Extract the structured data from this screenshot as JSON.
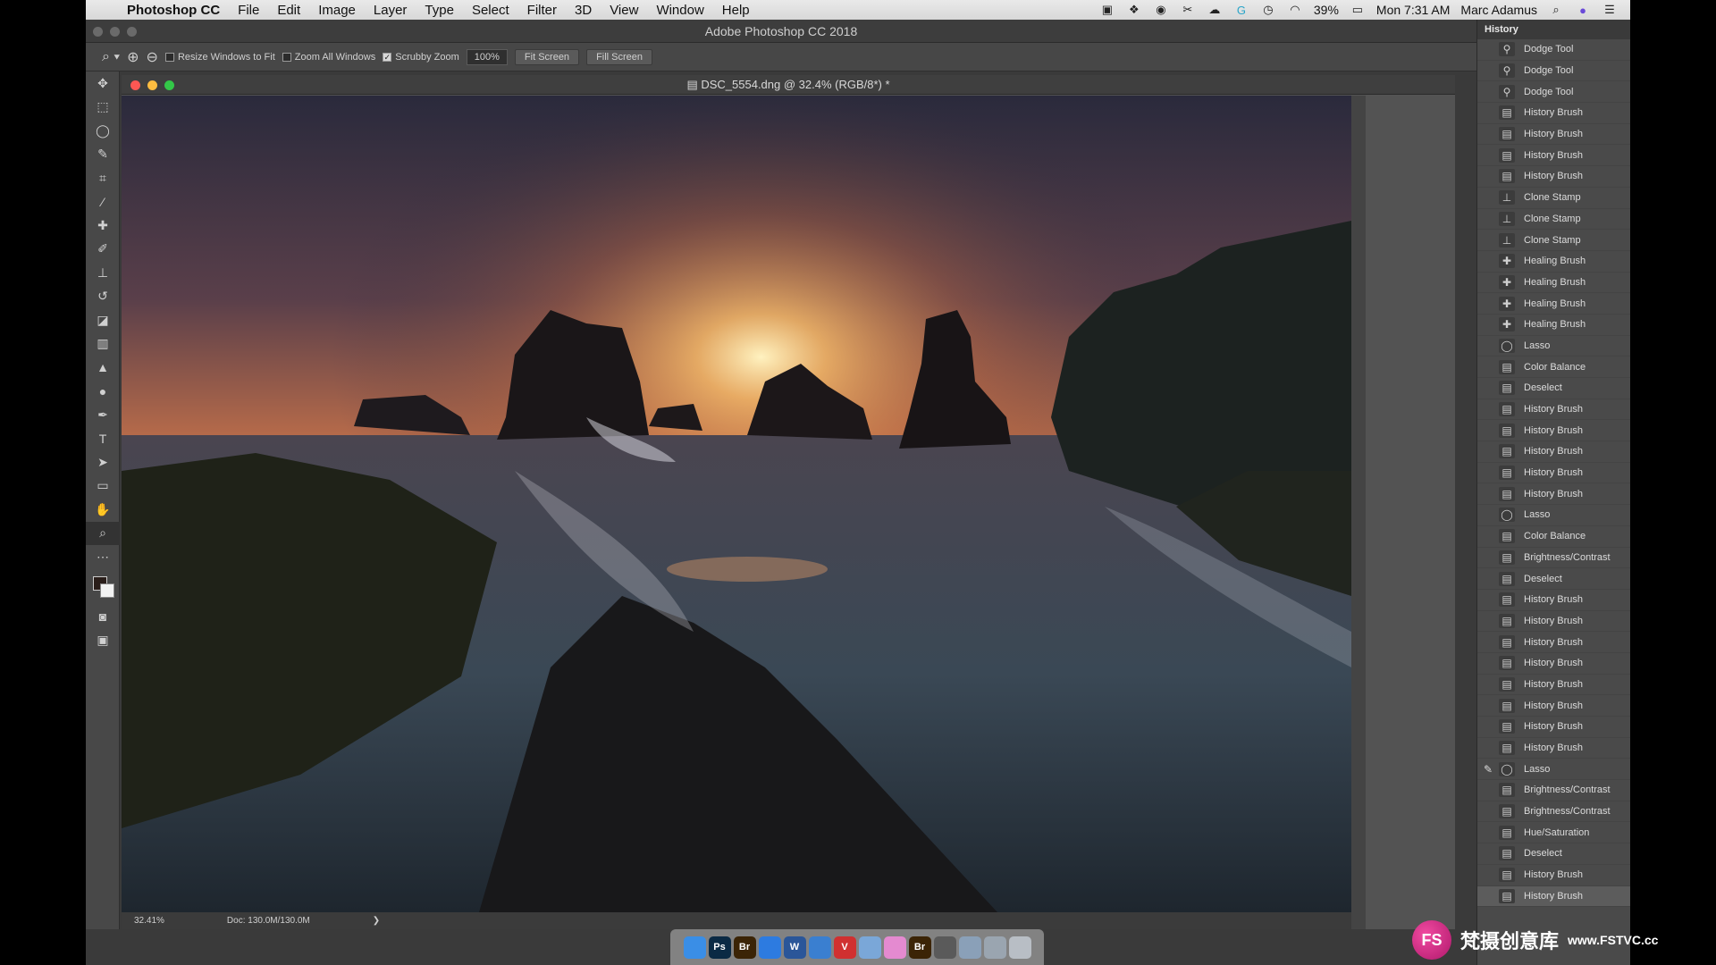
{
  "menubar": {
    "app_name": "Photoshop CC",
    "items": [
      "File",
      "Edit",
      "Image",
      "Layer",
      "Type",
      "Select",
      "Filter",
      "3D",
      "View",
      "Window",
      "Help"
    ],
    "battery": "39%",
    "clock": "Mon 7:31 AM",
    "user": "Marc Adamus",
    "status_icons": [
      "camera-icon",
      "dropbox-icon",
      "creative-cloud-icon",
      "tool-icon",
      "cloud-icon",
      "grammarly-icon",
      "time-machine-icon",
      "wifi-icon",
      "battery-icon"
    ]
  },
  "app_title": "Adobe Photoshop CC 2018",
  "options_bar": {
    "resize_windows": "Resize Windows to Fit",
    "zoom_all": "Zoom All Windows",
    "scrubby_zoom": "Scrubby Zoom",
    "zoom_value": "100%",
    "fit_screen": "Fit Screen",
    "fill_screen": "Fill Screen",
    "resize_checked": false,
    "zoom_all_checked": false,
    "scrubby_checked": true
  },
  "document": {
    "title": "DSC_5554.dng @ 32.4% (RGB/8*) *",
    "zoom": "32.41%",
    "doc_size": "Doc: 130.0M/130.0M",
    "arrow": "❯"
  },
  "history": {
    "tab_label": "History",
    "items": [
      {
        "label": "Dodge Tool",
        "icon": "dodge-icon"
      },
      {
        "label": "Dodge Tool",
        "icon": "dodge-icon"
      },
      {
        "label": "Dodge Tool",
        "icon": "dodge-icon"
      },
      {
        "label": "History Brush",
        "icon": "history-brush-icon"
      },
      {
        "label": "History Brush",
        "icon": "history-brush-icon"
      },
      {
        "label": "History Brush",
        "icon": "history-brush-icon"
      },
      {
        "label": "History Brush",
        "icon": "history-brush-icon"
      },
      {
        "label": "Clone Stamp",
        "icon": "clone-stamp-icon"
      },
      {
        "label": "Clone Stamp",
        "icon": "clone-stamp-icon"
      },
      {
        "label": "Clone Stamp",
        "icon": "clone-stamp-icon"
      },
      {
        "label": "Healing Brush",
        "icon": "healing-brush-icon"
      },
      {
        "label": "Healing Brush",
        "icon": "healing-brush-icon"
      },
      {
        "label": "Healing Brush",
        "icon": "healing-brush-icon"
      },
      {
        "label": "Healing Brush",
        "icon": "healing-brush-icon"
      },
      {
        "label": "Lasso",
        "icon": "lasso-icon"
      },
      {
        "label": "Color Balance",
        "icon": "adjustment-icon"
      },
      {
        "label": "Deselect",
        "icon": "adjustment-icon"
      },
      {
        "label": "History Brush",
        "icon": "history-brush-icon"
      },
      {
        "label": "History Brush",
        "icon": "history-brush-icon"
      },
      {
        "label": "History Brush",
        "icon": "history-brush-icon"
      },
      {
        "label": "History Brush",
        "icon": "history-brush-icon"
      },
      {
        "label": "History Brush",
        "icon": "history-brush-icon"
      },
      {
        "label": "Lasso",
        "icon": "lasso-icon"
      },
      {
        "label": "Color Balance",
        "icon": "adjustment-icon"
      },
      {
        "label": "Brightness/Contrast",
        "icon": "adjustment-icon"
      },
      {
        "label": "Deselect",
        "icon": "adjustment-icon"
      },
      {
        "label": "History Brush",
        "icon": "history-brush-icon"
      },
      {
        "label": "History Brush",
        "icon": "history-brush-icon"
      },
      {
        "label": "History Brush",
        "icon": "history-brush-icon"
      },
      {
        "label": "History Brush",
        "icon": "history-brush-icon"
      },
      {
        "label": "History Brush",
        "icon": "history-brush-icon"
      },
      {
        "label": "History Brush",
        "icon": "history-brush-icon"
      },
      {
        "label": "History Brush",
        "icon": "history-brush-icon"
      },
      {
        "label": "History Brush",
        "icon": "history-brush-icon"
      },
      {
        "label": "Lasso",
        "icon": "lasso-icon",
        "source_mark": true
      },
      {
        "label": "Brightness/Contrast",
        "icon": "adjustment-icon"
      },
      {
        "label": "Brightness/Contrast",
        "icon": "adjustment-icon"
      },
      {
        "label": "Hue/Saturation",
        "icon": "adjustment-icon"
      },
      {
        "label": "Deselect",
        "icon": "adjustment-icon"
      },
      {
        "label": "History Brush",
        "icon": "history-brush-icon"
      },
      {
        "label": "History Brush",
        "icon": "history-brush-icon",
        "selected": true
      }
    ]
  },
  "dock": {
    "apps": [
      {
        "label": "",
        "icon": "finder-icon",
        "color": "#3a8ee6"
      },
      {
        "label": "Ps",
        "icon": "photoshop-icon",
        "color": "#0b2a44"
      },
      {
        "label": "Br",
        "icon": "bridge-icon",
        "color": "#3b2406"
      },
      {
        "label": "",
        "icon": "safari-icon",
        "color": "#2d7be0"
      },
      {
        "label": "W",
        "icon": "word-icon",
        "color": "#2a5699"
      },
      {
        "label": "",
        "icon": "chrome-icon",
        "color": "#3a7fd0"
      },
      {
        "label": "V",
        "icon": "app-v-icon",
        "color": "#d03030"
      },
      {
        "label": "",
        "icon": "mail-icon",
        "color": "#7aa7d8"
      },
      {
        "label": "",
        "icon": "photos-icon",
        "color": "#e48ad0"
      },
      {
        "label": "Br",
        "icon": "bridge-icon",
        "color": "#3b2406"
      },
      {
        "label": "",
        "icon": "window-icon",
        "color": "#5a5a5a"
      },
      {
        "label": "",
        "icon": "window-icon",
        "color": "#8aa0b8"
      },
      {
        "label": "",
        "icon": "window-icon",
        "color": "#9aa5b0"
      },
      {
        "label": "",
        "icon": "trash-icon",
        "color": "#b8bec5"
      }
    ]
  },
  "watermark": {
    "logo": "FS",
    "text_cn": "梵摄创意库",
    "url": "www.FSTVC.cc"
  }
}
